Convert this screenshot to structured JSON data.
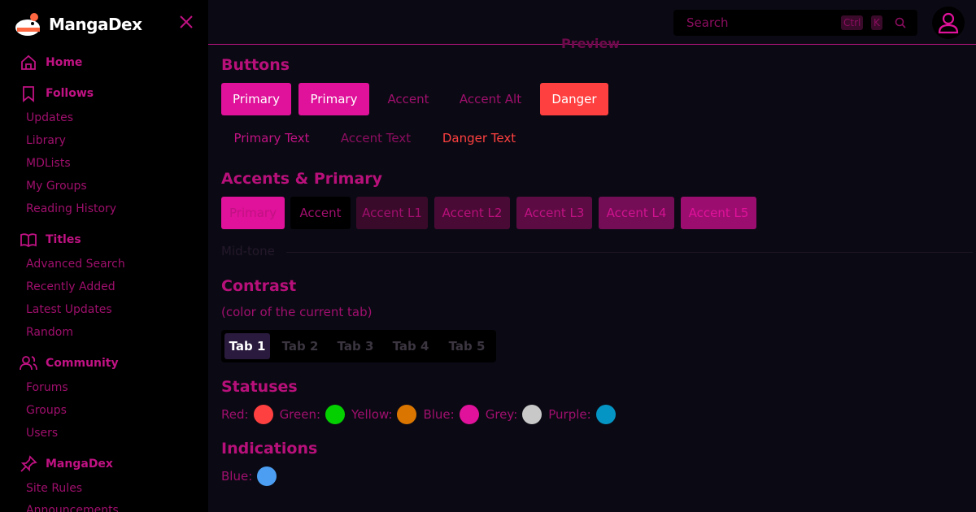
{
  "brand": {
    "name": "MangaDex"
  },
  "sidebar": {
    "home": "Home",
    "follows": {
      "label": "Follows",
      "items": [
        "Updates",
        "Library",
        "MDLists",
        "My Groups",
        "Reading History"
      ]
    },
    "titles": {
      "label": "Titles",
      "items": [
        "Advanced Search",
        "Recently Added",
        "Latest Updates",
        "Random"
      ]
    },
    "community": {
      "label": "Community",
      "items": [
        "Forums",
        "Groups",
        "Users"
      ]
    },
    "mangadex": {
      "label": "MangaDex",
      "items": [
        "Site Rules",
        "Announcements"
      ]
    }
  },
  "header": {
    "search_placeholder": "Search",
    "kbd_ctrl": "Ctrl",
    "kbd_k": "K"
  },
  "main": {
    "preview": "Preview",
    "buttons": {
      "heading": "Buttons",
      "row1": [
        "Primary",
        "Primary",
        "Accent",
        "Accent Alt",
        "Danger"
      ],
      "row2": [
        "Primary Text",
        "Accent Text",
        "Danger Text"
      ]
    },
    "accents": {
      "heading": "Accents & Primary",
      "swatches": [
        "Primary",
        "Accent",
        "Accent L1",
        "Accent L2",
        "Accent L3",
        "Accent L4",
        "Accent L5"
      ]
    },
    "midtone": "Mid-tone",
    "contrast": {
      "heading": "Contrast",
      "note": "(color of the current tab)",
      "tabs": [
        "Tab 1",
        "Tab 2",
        "Tab 3",
        "Tab 4",
        "Tab 5"
      ]
    },
    "statuses": {
      "heading": "Statuses",
      "items": [
        {
          "label": "Red:",
          "color": "#ff4040"
        },
        {
          "label": "Green:",
          "color": "#04d000"
        },
        {
          "label": "Yellow:",
          "color": "#da7500"
        },
        {
          "label": "Blue:",
          "color": "#e0119a"
        },
        {
          "label": "Grey:",
          "color": "#c8c8c8"
        },
        {
          "label": "Purple:",
          "color": "#0595c4"
        }
      ]
    },
    "indications": {
      "heading": "Indications",
      "items": [
        {
          "label": "Blue:",
          "color": "#4c9ef2"
        }
      ]
    }
  },
  "colors": {
    "accent": "#e0119a",
    "danger": "#ff4040",
    "background": "#0b0a14",
    "sidebar": "#000000"
  }
}
